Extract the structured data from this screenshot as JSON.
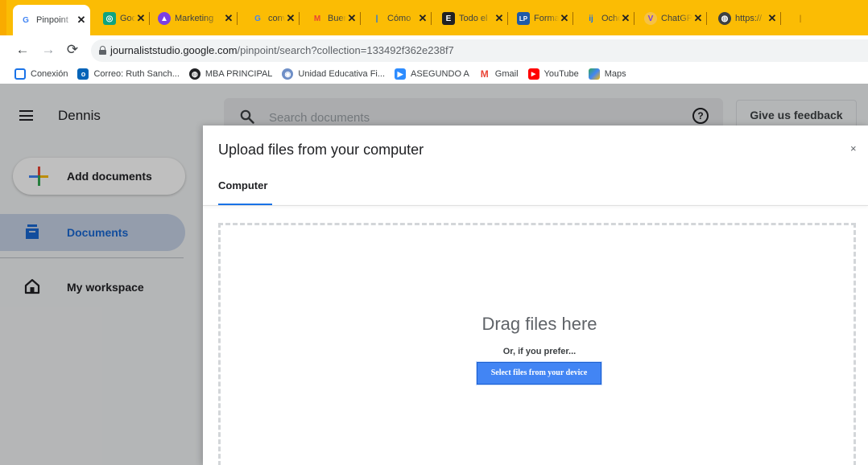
{
  "browser": {
    "tabs": [
      {
        "title": "Pinpoint",
        "favicon": "G",
        "active": true
      },
      {
        "title": "Google",
        "favicon": "openai"
      },
      {
        "title": "Marketing",
        "favicon": "triangle"
      },
      {
        "title": "conversor",
        "favicon": "G"
      },
      {
        "title": "Bueno",
        "favicon": "M"
      },
      {
        "title": "Cómo",
        "favicon": "|"
      },
      {
        "title": "Todo el",
        "favicon": "E"
      },
      {
        "title": "Formato",
        "favicon": "LP"
      },
      {
        "title": "Ocho",
        "favicon": "ij"
      },
      {
        "title": "ChatGPT",
        "favicon": "V"
      },
      {
        "title": "https://",
        "favicon": "globe"
      }
    ],
    "url_host": "journaliststudio.google.com",
    "url_path": "/pinpoint/search?collection=133492f362e238f7",
    "bookmarks": [
      {
        "label": "Conexión",
        "icon": "conexion-icon",
        "color": "#1a73e8"
      },
      {
        "label": "Correo: Ruth Sanch...",
        "icon": "outlook-icon",
        "color": "#0364b8"
      },
      {
        "label": "MBA PRINCIPAL",
        "icon": "globe-icon",
        "color": "#202124"
      },
      {
        "label": "Unidad Educativa Fi...",
        "icon": "school-icon",
        "color": "#6f8fc7"
      },
      {
        "label": "ASEGUNDO A",
        "icon": "zoom-icon",
        "color": "#2d8cff"
      },
      {
        "label": "Gmail",
        "icon": "gmail-icon",
        "color": "#ea4335"
      },
      {
        "label": "YouTube",
        "icon": "youtube-icon",
        "color": "#ff0000"
      },
      {
        "label": "Maps",
        "icon": "maps-icon",
        "color": "#34a853"
      }
    ]
  },
  "app": {
    "name": "Dennis",
    "search_placeholder": "Search documents",
    "help_symbol": "?",
    "feedback_label": "Give us feedback",
    "add_documents_label": "Add documents",
    "nav": [
      {
        "label": "Documents",
        "selected": true
      },
      {
        "label": "My workspace",
        "selected": false
      }
    ]
  },
  "dialog": {
    "title": "Upload files from your computer",
    "close_symbol": "×",
    "tab_label": "Computer",
    "drop_text": "Drag files here",
    "prefer_text": "Or, if you prefer...",
    "select_button": "Select files from your device"
  },
  "colors": {
    "accent": "#1a73e8",
    "tabstrip": "#fbbc04",
    "button": "#4285f4"
  }
}
